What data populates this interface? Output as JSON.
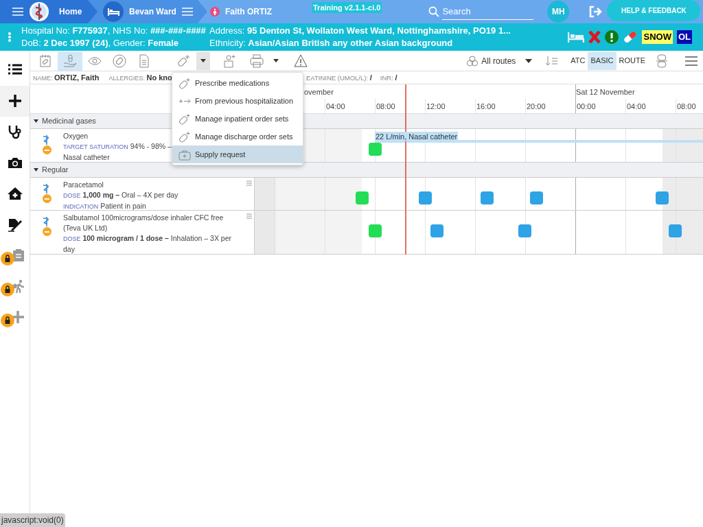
{
  "top_bar": {
    "breadcrumbs": [
      {
        "kind": "home",
        "label": "Home"
      },
      {
        "kind": "ward",
        "label": "Bevan Ward"
      },
      {
        "kind": "patient",
        "label": "Faith ORTIZ"
      }
    ],
    "environment_badge": "Training v2.1.1-ci.0",
    "search": {
      "placeholder": "Search"
    },
    "user_initials": "MH",
    "help_button": "HELP & FEEDBACK"
  },
  "patient_banner": {
    "details": [
      "Hospital No: **F775937**, NHS No: **###-###-####**",
      "DoB: **2 Dec 1997 (24)**, Gender: **Female**"
    ],
    "address": [
      "Address: **95 Denton St, Wollaton West Ward, Nottinghamshire, PO19 1...**",
      "Ethnicity: **Asian/Asian British any other Asian background**"
    ],
    "alerts": [
      {
        "kind": "bed"
      },
      {
        "kind": "cross"
      },
      {
        "kind": "warning"
      },
      {
        "kind": "pill"
      },
      {
        "kind": "tag",
        "label": "SNOW",
        "color": "#ffff66"
      },
      {
        "kind": "tag",
        "label": "OL",
        "color": "#0a0ab4"
      }
    ]
  },
  "sidebar": {
    "items": [
      {
        "kind": "list",
        "selected": false,
        "locked": false
      },
      {
        "kind": "plus",
        "selected": true,
        "locked": false
      },
      {
        "kind": "stethoscope",
        "selected": false,
        "locked": false
      },
      {
        "kind": "camera",
        "selected": false,
        "locked": false
      },
      {
        "kind": "house",
        "selected": false,
        "locked": false
      },
      {
        "kind": "sign",
        "selected": false,
        "locked": false
      },
      {
        "kind": "clipboard",
        "selected": false,
        "locked": true
      },
      {
        "kind": "walker",
        "selected": false,
        "locked": true
      },
      {
        "kind": "plus",
        "selected": false,
        "locked": true
      }
    ]
  },
  "toolbar": {
    "tools": [
      {
        "kind": "notepad",
        "selected": false
      },
      {
        "kind": "hand",
        "selected": true
      },
      {
        "kind": "eye",
        "selected": false
      },
      {
        "kind": "pill-circle",
        "selected": false
      },
      {
        "kind": "document",
        "selected": false
      },
      {
        "kind": "pill-plus",
        "selected": false
      },
      {
        "kind": "dropdown",
        "selected": true
      },
      {
        "kind": "person",
        "selected": false
      },
      {
        "kind": "printer",
        "selected": false
      },
      {
        "kind": "dropdown",
        "selected": false
      },
      {
        "kind": "warning",
        "selected": false
      }
    ],
    "route_filter": "All routes",
    "view_modes": [
      {
        "label": "ATC",
        "selected": false
      },
      {
        "label": "BASIC",
        "selected": true
      },
      {
        "label": "ROUTE",
        "selected": false
      }
    ]
  },
  "patient_info": [
    {
      "label": "NAME:",
      "value": "ORTIZ, Faith"
    },
    {
      "label": "ALLERGIES:",
      "value": "No kno"
    },
    {
      "label": "EATININE (UMOL/L):",
      "value": "/"
    },
    {
      "label": "INR:",
      "value": "/"
    }
  ],
  "timeline": {
    "dates": [
      "ovember",
      "Sat 12 November"
    ],
    "hours": [
      {
        "label": "04:00",
        "day_start": false
      },
      {
        "label": "08:00",
        "day_start": false
      },
      {
        "label": "12:00",
        "day_start": false
      },
      {
        "label": "16:00",
        "day_start": false
      },
      {
        "label": "20:00",
        "day_start": false
      },
      {
        "label": "00:00",
        "day_start": true
      },
      {
        "label": "04:00",
        "day_start": false
      },
      {
        "label": "08:00",
        "day_start": false
      }
    ],
    "groups": [
      {
        "name": "Medicinal gases",
        "expanded": true,
        "items": [
          {
            "name": "Oxygen",
            "lines": [
              {
                "label": "TARGET SATURATION",
                "text": "94% - 98% –"
              },
              {
                "text": "Nasal catheter"
              }
            ],
            "has_menu": false,
            "infusion": {
              "label": "22 L/min, Nasal catheter"
            },
            "doses": [
              {
                "kind": "given"
              }
            ]
          }
        ]
      },
      {
        "name": "Regular",
        "expanded": true,
        "items": [
          {
            "name": "Paracetamol",
            "lines": [
              {
                "label": "DOSE",
                "text": "**1,000 mg –** Oral – 4X per day"
              },
              {
                "label": "INDICATION",
                "text": "Patient in pain"
              }
            ],
            "has_menu": true,
            "doses": [
              {
                "kind": "given"
              },
              {
                "kind": "planned"
              },
              {
                "kind": "planned"
              },
              {
                "kind": "planned"
              },
              {
                "kind": "planned"
              }
            ]
          },
          {
            "name": "Salbutamol 100micrograms/dose inhaler CFC free (Teva UK Ltd)",
            "lines": [
              {
                "label": "DOSE",
                "text": "**100 microgram / 1 dose –** Inhalation – 3X per day"
              }
            ],
            "has_menu": true,
            "doses": [
              {
                "kind": "given"
              },
              {
                "kind": "planned"
              },
              {
                "kind": "planned"
              },
              {
                "kind": "planned"
              }
            ]
          }
        ]
      }
    ]
  },
  "menu": {
    "items": [
      {
        "kind": "pill",
        "label": "Prescribe medications",
        "selected": false
      },
      {
        "kind": "arrow",
        "label": "From previous hospitalization",
        "selected": false
      },
      {
        "kind": "pill",
        "label": "Manage inpatient order sets",
        "selected": false
      },
      {
        "kind": "pill",
        "label": "Manage discharge order sets",
        "selected": false
      },
      {
        "kind": "case",
        "label": "Supply request",
        "selected": true
      }
    ]
  },
  "status_tooltip": "javascript:void(0)"
}
